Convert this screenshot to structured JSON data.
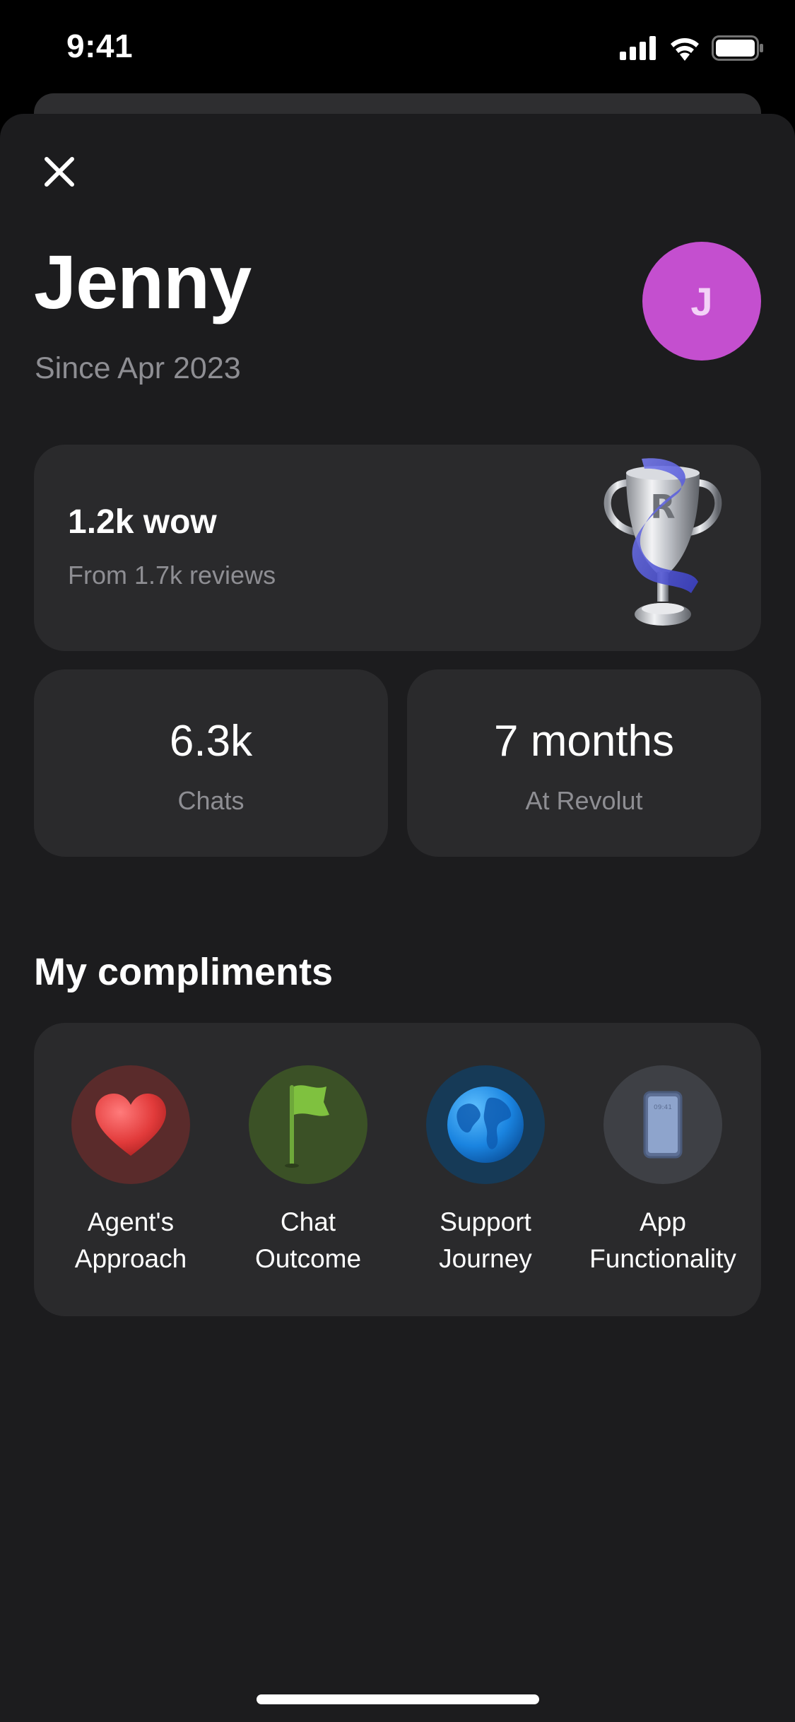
{
  "status_bar": {
    "time": "9:41",
    "signal_icon": "cellular-signal-icon",
    "wifi_icon": "wifi-icon",
    "battery_icon": "battery-icon"
  },
  "profile": {
    "name": "Jenny",
    "since": "Since Apr 2023",
    "avatar_initial": "J",
    "avatar_color": "#c44fcf"
  },
  "wow_card": {
    "title": "1.2k wow",
    "subtitle": "From 1.7k reviews",
    "icon": "trophy-icon"
  },
  "stats": [
    {
      "value": "6.3k",
      "label": "Chats"
    },
    {
      "value": "7 months",
      "label": "At Revolut"
    }
  ],
  "compliments": {
    "title": "My compliments",
    "items": [
      {
        "line1": "Agent's",
        "line2": "Approach",
        "icon": "heart-icon",
        "bg": "#5a2b2b"
      },
      {
        "line1": "Chat",
        "line2": "Outcome",
        "icon": "flag-icon",
        "bg": "#3b5126"
      },
      {
        "line1": "Support",
        "line2": "Journey",
        "icon": "globe-icon",
        "bg": "#163a57"
      },
      {
        "line1": "App",
        "line2": "Functionality",
        "icon": "phone-icon",
        "bg": "#3e4045"
      }
    ]
  },
  "phone_icon_time": "09:41"
}
